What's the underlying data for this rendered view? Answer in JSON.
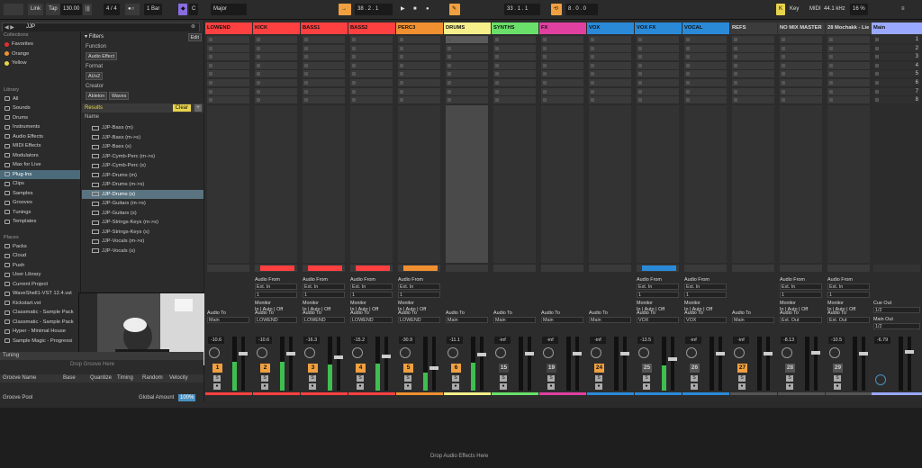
{
  "transport": {
    "link": "Link",
    "tap": "Tap",
    "tempo": "130.00",
    "time_sig_num": "4",
    "time_sig_den": "4",
    "quantize": "1 Bar",
    "key": "C",
    "scale": "Major",
    "position": "38 . 2 . 1",
    "loop_start": "33 . 1 . 1",
    "loop_length": "8 . 0 . 0",
    "key_label": "Key",
    "midi_label": "MIDI",
    "sample_rate": "44.1 kHz",
    "cpu": "16 %"
  },
  "browser": {
    "search_value": "JJP",
    "collections_header": "Collections",
    "collections": [
      {
        "label": "Favorites",
        "color": "#e03030"
      },
      {
        "label": "Orange",
        "color": "#f09030"
      },
      {
        "label": "Yellow",
        "color": "#e8d44c"
      }
    ],
    "library_header": "Library",
    "library": [
      "All",
      "Sounds",
      "Drums",
      "Instruments",
      "Audio Effects",
      "MIDI Effects",
      "Modulators",
      "Max for Live",
      "Plug-Ins",
      "Clips",
      "Samples",
      "Grooves",
      "Tunings",
      "Templates"
    ],
    "selected_library": "Plug-Ins",
    "places_header": "Places",
    "places": [
      "Packs",
      "Cloud",
      "Push",
      "User Library",
      "Current Project",
      "WaveShell1-VST 12.4.vst",
      "Kickstart.vst",
      "Classmatic - Sample Pack",
      "Classmatic - Sample Pack",
      "Hyper - Minimal House",
      "Sample Magic - Progressi"
    ],
    "filters_label": "Filters",
    "edit_label": "Edit",
    "function_label": "Function",
    "function_value": "Audio Effect",
    "format_label": "Format",
    "format_value": "AUv2",
    "creator_label": "Creator",
    "creator_values": [
      "Ableton",
      "Waves"
    ],
    "results_label": "Results",
    "clear_label": "Clear",
    "name_header": "Name",
    "results": [
      "JJP-Bass (m)",
      "JJP-Bass (m->s)",
      "JJP-Bass (s)",
      "JJP-Cymb-Perc (m->s)",
      "JJP-Cymb-Perc (s)",
      "JJP-Drums (m)",
      "JJP-Drums (m->s)",
      "JJP-Drums (s)",
      "JJP-Guitars (m->s)",
      "JJP-Guitars (s)",
      "JJP-Strings-Keys (m->s)",
      "JJP-Strings-Keys (s)",
      "JJP-Vocals (m->s)",
      "JJP-Vocals (s)"
    ],
    "selected_result": "JJP-Drums (s)"
  },
  "groove": {
    "tuning_label": "Tuning",
    "drop_hint": "Drop Groove Here",
    "columns": [
      "Groove Name",
      "Base",
      "Quantize",
      "Timing",
      "Random",
      "Velocity"
    ],
    "pool_label": "Groove Pool",
    "global_amount_label": "Global Amount",
    "global_amount_value": "100%"
  },
  "tracks": [
    {
      "name": "LOWEND",
      "color": "#ff4040",
      "in": "",
      "out": "Main",
      "vol": "-10.6",
      "num": "1",
      "active": true,
      "clip": "",
      "fader": 0.72
    },
    {
      "name": "KICK",
      "color": "#ff4040",
      "in": "Ext. In",
      "out": "LOWEND",
      "vol": "-10.6",
      "num": "2",
      "active": true,
      "clip": "#ff4040",
      "fader": 0.72
    },
    {
      "name": "BASS1",
      "color": "#ff4040",
      "in": "Ext. In",
      "out": "LOWEND",
      "vol": "-16.3",
      "num": "3",
      "active": true,
      "clip": "#ff4040",
      "fader": 0.65
    },
    {
      "name": "BASS2",
      "color": "#ff4040",
      "in": "Ext. In",
      "out": "LOWEND",
      "vol": "-15.2",
      "num": "4",
      "active": true,
      "clip": "#ff4040",
      "fader": 0.66
    },
    {
      "name": "PERC3",
      "color": "#f09030",
      "in": "Ext. In",
      "out": "LOWEND",
      "vol": "-30.9",
      "num": "5",
      "active": true,
      "clip": "#f09030",
      "fader": 0.45
    },
    {
      "name": "DRUMS",
      "color": "#f5f08a",
      "in": "",
      "out": "Main",
      "vol": "-11.1",
      "num": "6",
      "active": true,
      "clip": "",
      "fader": 0.7
    },
    {
      "name": "SYNTHS",
      "color": "#6ae06a",
      "in": "",
      "out": "Main",
      "vol": "-inf",
      "num": "15",
      "active": false,
      "clip": "",
      "fader": 0.72
    },
    {
      "name": "FX",
      "color": "#e040a0",
      "in": "",
      "out": "Main",
      "vol": "-inf",
      "num": "19",
      "active": false,
      "clip": "",
      "fader": 0.72
    },
    {
      "name": "VOX",
      "color": "#2a8ad8",
      "in": "",
      "out": "Main",
      "vol": "-inf",
      "num": "24",
      "active": true,
      "clip": "",
      "fader": 0.72
    },
    {
      "name": "VOX FX",
      "color": "#2a8ad8",
      "in": "Ext. In",
      "out": "VOX",
      "vol": "-13.5",
      "num": "25",
      "active": false,
      "clip": "#2a8ad8",
      "fader": 0.62
    },
    {
      "name": "VOCAL",
      "color": "#2a8ad8",
      "in": "Ext. In",
      "out": "VOX",
      "vol": "-inf",
      "num": "26",
      "active": false,
      "clip": "",
      "fader": 0.72
    },
    {
      "name": "REFS",
      "color": "#555555",
      "in": "",
      "out": "Main",
      "vol": "-inf",
      "num": "27",
      "active": true,
      "clip": "",
      "fader": 0.72
    },
    {
      "name": "NO MIX MASTER",
      "color": "#555555",
      "in": "Ext. In",
      "out": "Ext. Out",
      "vol": "-8.13",
      "num": "28",
      "active": false,
      "clip": "",
      "fader": 0.74
    },
    {
      "name": "28 Mochakk - Lie",
      "color": "#555555",
      "in": "Ext. In",
      "out": "Ext. Out",
      "vol": "-10.5",
      "num": "29",
      "active": false,
      "clip": "",
      "fader": 0.72
    }
  ],
  "main_track": {
    "name": "Main",
    "color": "#9aa8ff",
    "scenes": [
      "1",
      "2",
      "3",
      "4",
      "5",
      "6",
      "7",
      "8"
    ],
    "cue_out_label": "Cue Out",
    "cue_out_value": "1/2",
    "main_out_label": "Main Out",
    "main_out_value": "1/2",
    "vol": "-6.79"
  },
  "mixer_labels": {
    "audio_from": "Audio From",
    "monitor": "Monitor",
    "monitor_in": "In",
    "monitor_auto": "Auto",
    "monitor_off": "Off",
    "audio_to": "Audio To",
    "input_channel": "1",
    "scale_ticks": [
      "-inf",
      "12",
      "24",
      "36",
      "48",
      "60"
    ]
  },
  "status": {
    "drop_effects": "Drop Audio Effects Here"
  }
}
